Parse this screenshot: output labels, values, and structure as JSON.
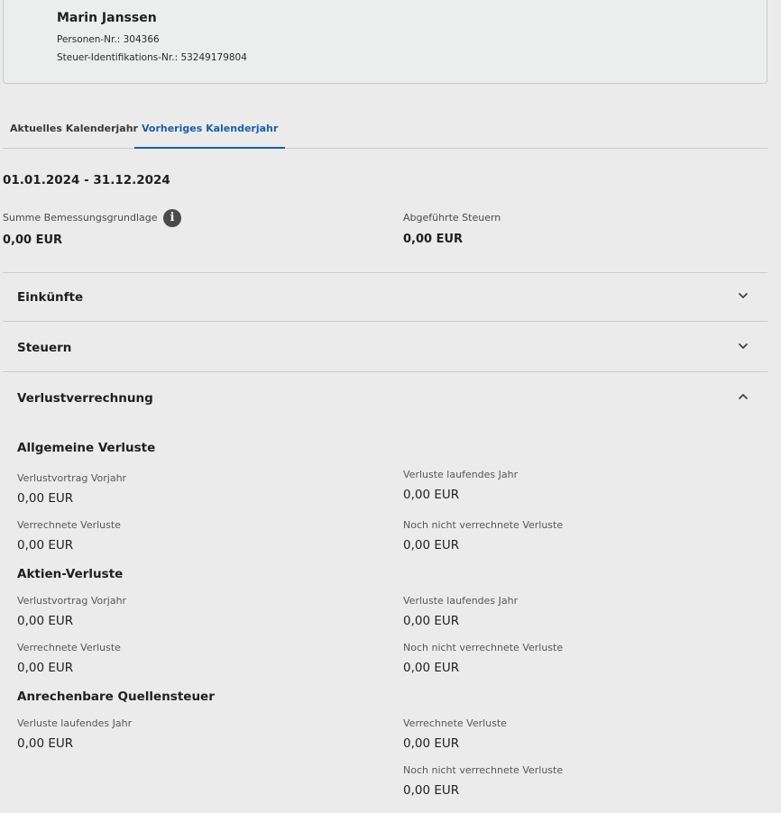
{
  "customer": {
    "name": "Marin Janssen",
    "person_no": "Personen-Nr.: 304366",
    "tax_id": "Steuer-Identifikations-Nr.: 53249179804"
  },
  "tabs": [
    {
      "label": "Aktuelles Kalenderjahr",
      "active": false
    },
    {
      "label": "Vorheriges Kalenderjahr",
      "active": true
    }
  ],
  "period": "01.01.2024 - 31.12.2024",
  "summary": {
    "base_label": "Summe Bemessungsgrundlage",
    "base_value": "0,00 EUR",
    "taxes_label": "Abgeführte Steuern",
    "taxes_value": "0,00 EUR",
    "info_icon": "info-icon"
  },
  "accordion": {
    "income": {
      "title": "Einkünfte",
      "expanded": false,
      "icon": "chevron-down-icon"
    },
    "taxes": {
      "title": "Steuern",
      "expanded": false,
      "icon": "chevron-down-icon"
    },
    "loss": {
      "title": "Verlustverrechnung",
      "expanded": true,
      "icon": "chevron-up-icon"
    }
  },
  "loss_sections": {
    "general": {
      "title": "Allgemeine Verluste",
      "carry_label": "Verlustvortrag Vorjahr",
      "carry_value": "0,00 EUR",
      "current_label": "Verluste laufendes Jahr",
      "current_value": "0,00 EUR",
      "offset_label": "Verrechnete Verluste",
      "offset_value": "0,00 EUR",
      "open_label": "Noch nicht verrechnete Verluste",
      "open_value": "0,00 EUR"
    },
    "stocks": {
      "title": "Aktien-Verluste",
      "carry_label": "Verlustvortrag Vorjahr",
      "carry_value": "0,00 EUR",
      "current_label": "Verluste laufendes Jahr",
      "current_value": "0,00 EUR",
      "offset_label": "Verrechnete Verluste",
      "offset_value": "0,00 EUR",
      "open_label": "Noch nicht verrechnete Verluste",
      "open_value": "0,00 EUR"
    },
    "withholding": {
      "title": "Anrechenbare Quellensteuer",
      "current_label": "Verluste laufendes Jahr",
      "current_value": "0,00 EUR",
      "offset_label": "Verrechnete Verluste",
      "offset_value": "0,00 EUR",
      "open_label": "Noch nicht verrechnete Verluste",
      "open_value": "0,00 EUR"
    }
  },
  "colors": {
    "accent": "#1a5fa3",
    "background": "#ebebec",
    "text": "#1f1f1f"
  }
}
